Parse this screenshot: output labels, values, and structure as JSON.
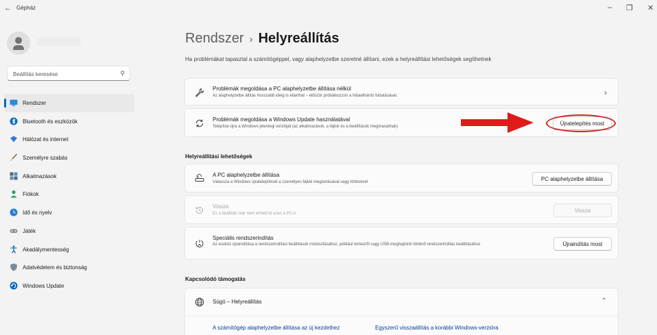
{
  "window": {
    "title": "Gépház"
  },
  "search": {
    "placeholder": "Beállítás keresése"
  },
  "sidebar": {
    "items": [
      {
        "label": "Rendszer",
        "active": true,
        "color": "#0067c0",
        "icon": "monitor-icon"
      },
      {
        "label": "Bluetooth és eszközök",
        "color": "#0067c0",
        "icon": "bluetooth-icon"
      },
      {
        "label": "Hálózat és internet",
        "color": "#2b7bd8",
        "icon": "wifi-icon"
      },
      {
        "label": "Személyre szabás",
        "color": "#c06010",
        "icon": "brush-icon"
      },
      {
        "label": "Alkalmazások",
        "color": "#4a6a8a",
        "icon": "apps-icon"
      },
      {
        "label": "Fiókok",
        "color": "#2aa05a",
        "icon": "account-icon"
      },
      {
        "label": "Idő és nyelv",
        "color": "#2b7bd8",
        "icon": "globe-clock-icon"
      },
      {
        "label": "Játék",
        "color": "#7a7a7a",
        "icon": "gamepad-icon"
      },
      {
        "label": "Akadálymentesség",
        "color": "#1a6ac0",
        "icon": "accessibility-icon"
      },
      {
        "label": "Adatvédelem és biztonság",
        "color": "#6a7a8a",
        "icon": "shield-icon"
      },
      {
        "label": "Windows Update",
        "color": "#0067c0",
        "icon": "update-icon"
      }
    ]
  },
  "header": {
    "breadcrumb_parent": "Rendszer",
    "breadcrumb_separator": "›",
    "title": "Helyreállítás",
    "subtitle": "Ha problémákat tapasztal a számítógéppel, vagy alaphelyzetbe szeretné állítani, ezek a helyreállítási lehetőségek segíthetnek"
  },
  "top_cards": [
    {
      "title": "Problémák megoldása a PC alaphelyzetbe állítása nélkül",
      "description": "Az alaphelyzetbe állítás hosszabb ideig is eltarthat – először próbálkozzon a hibaelhárító futtatásával.",
      "icon": "wrench-icon"
    },
    {
      "title": "Problémák megoldása a Windows Update használatával",
      "description": "Telepítse újra a Windows jelenlegi verzióját (az alkalmazások, a fájlok és a beállítások megmaradnak)",
      "button": "Újratelepítés most",
      "icon": "refresh-icon"
    }
  ],
  "recovery": {
    "heading": "Helyreállítási lehetőségek",
    "items": [
      {
        "title": "A PC alaphelyzetbe állítása",
        "description": "Válassza a Windows újratelepítését a személyes fájlok megtartásával vagy törlésével",
        "button": "PC alaphelyzetbe állítása",
        "icon": "reset-pc-icon"
      },
      {
        "title": "Vissza",
        "description": "Ez a beállítás már nem érhető el ezen a PC-n.",
        "button": "Vissza",
        "disabled": true,
        "icon": "history-icon"
      },
      {
        "title": "Speciális rendszerindítás",
        "description": "Az eszköz újraindítása a rendszerindítási beállítások módosításához, például lemezről vagy USB-meghajtóról történő rendszerindítás beállításához",
        "button": "Újraindítás most",
        "icon": "advanced-startup-icon"
      }
    ]
  },
  "support": {
    "heading": "Kapcsolódó támogatás",
    "item_title": "Súgó – Helyreállítás",
    "links": [
      "A számítógép alaphelyzetbe állítása az új kezdethez",
      "Egyszerű visszaállítás a korábbi Windows-verzióra"
    ]
  },
  "annotation": {
    "arrow_color": "#e01b1b",
    "circle_color": "#d42424"
  },
  "colors": {
    "accent": "#0067c0",
    "background": "#f3f3f3",
    "card": "#fbfbfb",
    "link": "#003e92"
  }
}
